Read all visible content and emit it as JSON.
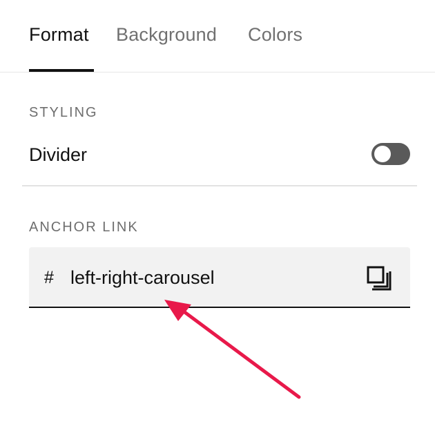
{
  "tabs": [
    {
      "label": "Format",
      "active": true
    },
    {
      "label": "Background",
      "active": false
    },
    {
      "label": "Colors",
      "active": false
    }
  ],
  "styling": {
    "heading": "STYLING",
    "divider_label": "Divider",
    "divider_enabled": false
  },
  "anchor": {
    "heading": "ANCHOR LINK",
    "prefix": "#",
    "value": "left-right-carousel",
    "copy_icon": "copy-icon"
  },
  "annotation": {
    "color": "#e8194a",
    "icon": "arrow-annotation"
  }
}
